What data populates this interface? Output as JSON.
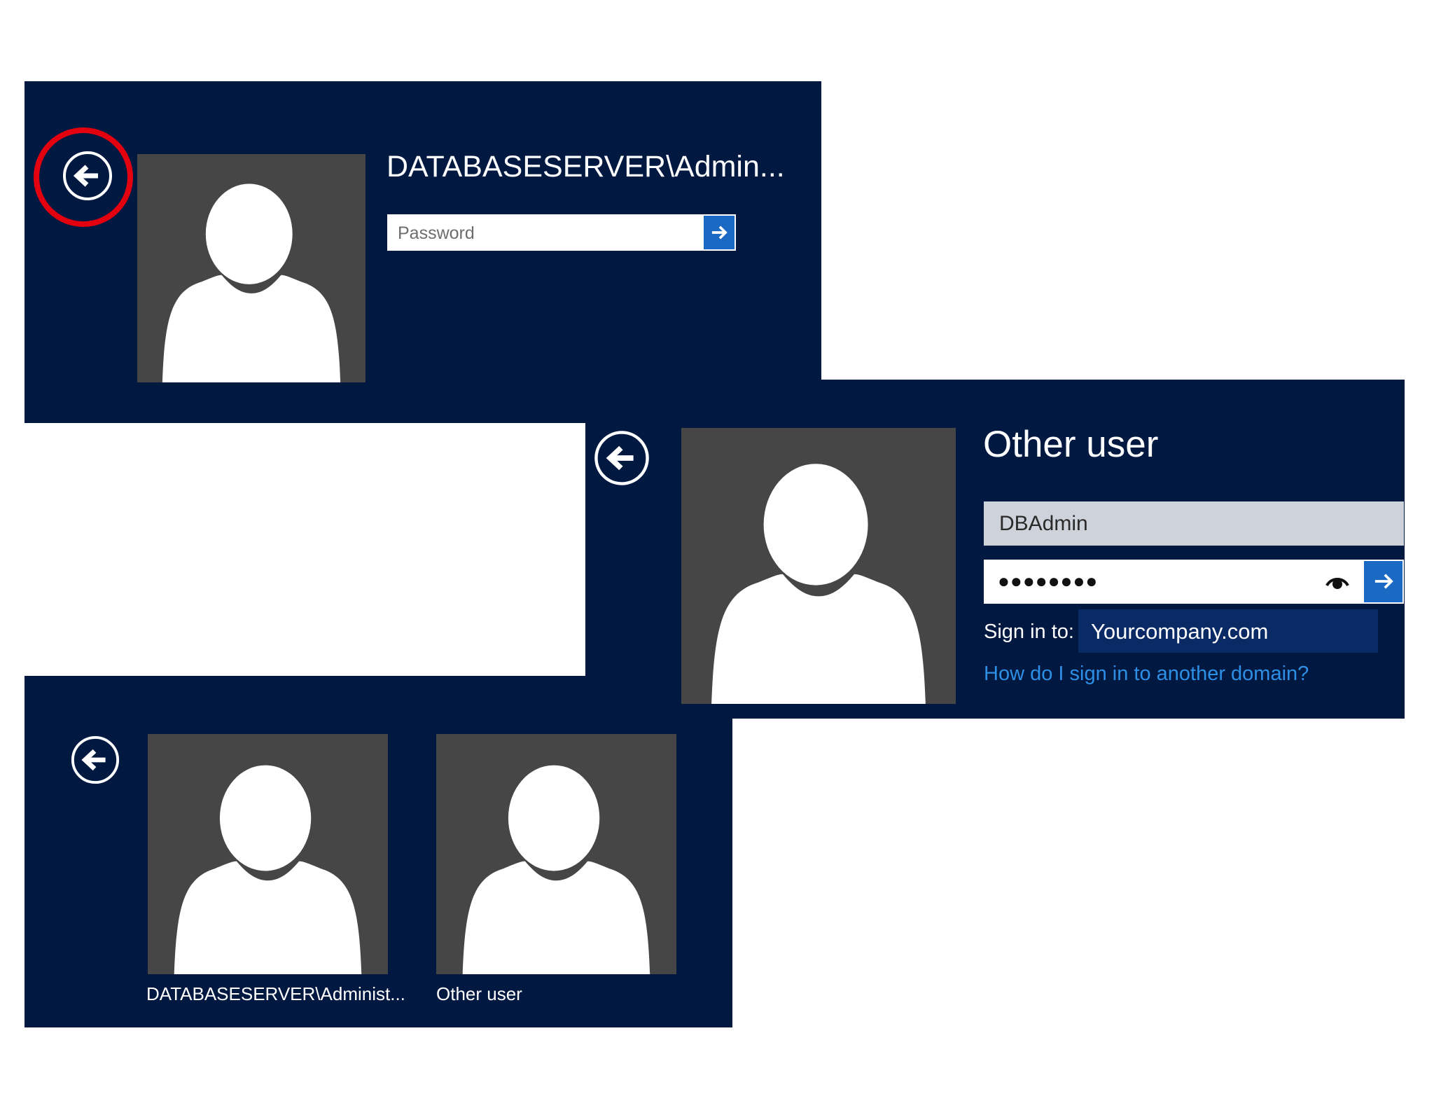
{
  "panel_password": {
    "account_name": "DATABASESERVER\\Admin...",
    "password_placeholder": "Password"
  },
  "panel_other_user": {
    "title": "Other user",
    "username_value": "DBAdmin",
    "password_value": "●●●●●●●●",
    "sign_in_to_label": "Sign in to:",
    "domain_value": "Yourcompany.com",
    "help_link": "How do I sign in to another domain?"
  },
  "panel_user_select": {
    "tiles": [
      {
        "label": "DATABASESERVER\\Administ..."
      },
      {
        "label": "Other user"
      }
    ]
  },
  "colors": {
    "panel_background": "#011841",
    "avatar_background": "#464646",
    "accent_button": "#1a6ac3",
    "link": "#2d8fe5",
    "highlight_circle": "#e3000f"
  },
  "icons": {
    "back": "back-arrow-icon",
    "submit": "arrow-right-icon",
    "reveal": "eye-icon",
    "avatar": "user-silhouette-icon"
  }
}
